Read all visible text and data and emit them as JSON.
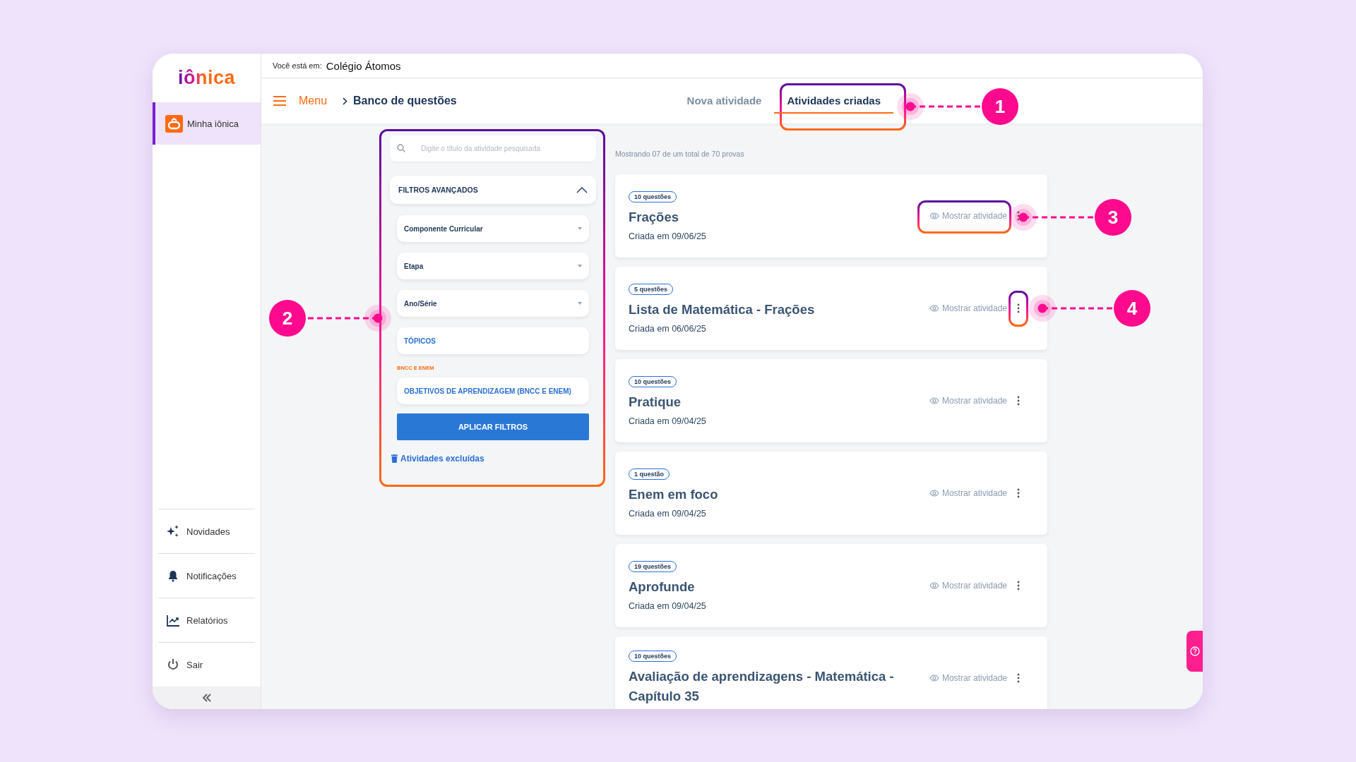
{
  "logo": "iônica",
  "sidebar": {
    "items": [
      {
        "label": "Minha iônica",
        "kind": "main",
        "selected": true
      },
      {
        "label": "Novidades",
        "kind": "footer",
        "selected": false
      },
      {
        "label": "Notificações",
        "kind": "footer",
        "selected": false
      },
      {
        "label": "Relatórios",
        "kind": "footer",
        "selected": false
      },
      {
        "label": "Sair",
        "kind": "footer",
        "selected": false
      }
    ]
  },
  "location": {
    "prefix": "Você está em:",
    "school": "Colégio Átomos"
  },
  "header": {
    "menu": "Menu",
    "breadcrumb": "Banco de questões"
  },
  "tabs": [
    {
      "label": "Nova atividade",
      "selected": false
    },
    {
      "label": "Atividades criadas",
      "selected": true
    }
  ],
  "filters": {
    "search": {
      "placeholder": "Digite o título da atividade pesquisada"
    },
    "section": {
      "label": "FILTROS AVANÇADOS",
      "expanded": true
    },
    "items": [
      {
        "kind": "select",
        "label": "Componente Curricular"
      },
      {
        "kind": "select",
        "label": "Etapa"
      },
      {
        "kind": "select",
        "label": "Ano/Série"
      },
      {
        "kind": "picker",
        "label": "TÓPICOS"
      },
      {
        "kind": "label",
        "label": "BNCC E ENEM"
      },
      {
        "kind": "picker",
        "label": "OBJETIVOS DE APRENDIZAGEM (BNCC E ENEM)"
      }
    ],
    "apply": "APLICAR FILTROS",
    "deleted_link": "Atividades excluídas"
  },
  "results": {
    "summary": "Mostrando 07 de um total de 70 provas",
    "cards": [
      {
        "badge": "10 questões",
        "title": "Frações",
        "date": "Criada em 09/06/25",
        "show": "Mostrar atividade"
      },
      {
        "badge": "5 questões",
        "title": "Lista de Matemática - Frações",
        "date": "Criada em 06/06/25",
        "show": "Mostrar atividade"
      },
      {
        "badge": "10 questões",
        "title": "Pratique",
        "date": "Criada em 09/04/25",
        "show": "Mostrar atividade"
      },
      {
        "badge": "1 questão",
        "title": "Enem em foco",
        "date": "Criada em 09/04/25",
        "show": "Mostrar atividade"
      },
      {
        "badge": "19 questões",
        "title": "Aprofunde",
        "date": "Criada em 09/04/25",
        "show": "Mostrar atividade"
      },
      {
        "badge": "10 questões",
        "title": "Avaliação de aprendizagens - Matemática - Capítulo 35",
        "show": "Mostrar atividade"
      }
    ]
  },
  "annotations": [
    {
      "label": "1"
    },
    {
      "label": "2"
    },
    {
      "label": "3"
    },
    {
      "label": "4"
    }
  ]
}
